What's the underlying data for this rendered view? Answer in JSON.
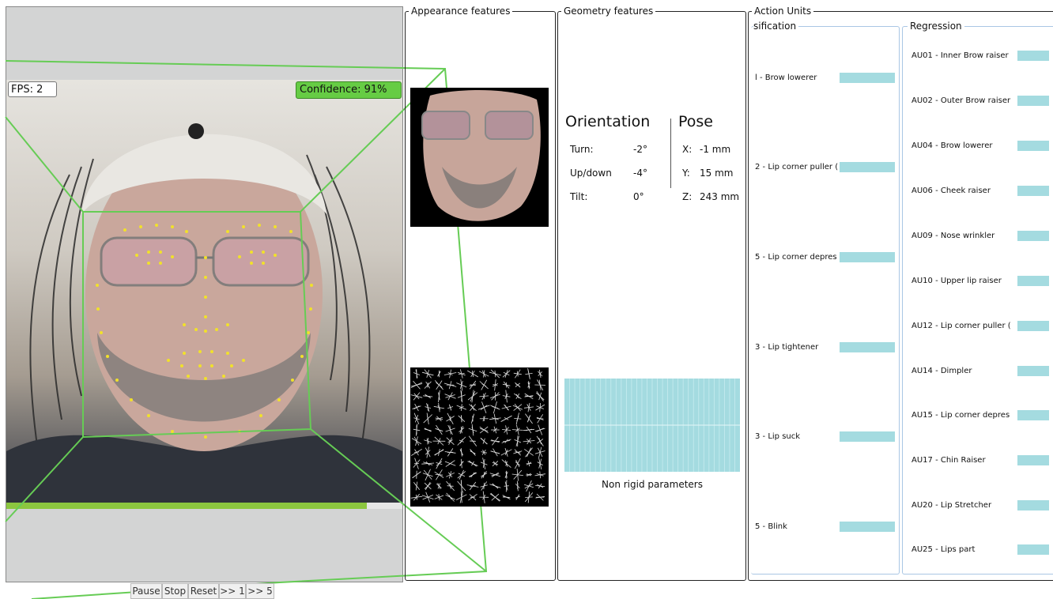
{
  "video": {
    "fps_label": "FPS: 2",
    "confidence_label": "Confidence: 91%",
    "confidence_value": 0.91,
    "accent_color": "#66cc44"
  },
  "appearance": {
    "title": "Appearance features"
  },
  "geometry": {
    "title": "Geometry features",
    "orientation_title": "Orientation",
    "pose_title": "Pose",
    "orientation_rows": [
      {
        "label": "Turn:",
        "value": "-2°"
      },
      {
        "label": "Up/down",
        "value": "-4°"
      },
      {
        "label": "Tilt:",
        "value": "0°"
      }
    ],
    "pose_rows": [
      {
        "label": "X:",
        "value": "-1 mm"
      },
      {
        "label": "Y:",
        "value": "15 mm"
      },
      {
        "label": "Z:",
        "value": "243 mm"
      }
    ],
    "non_rigid_label": "Non rigid parameters"
  },
  "action_units": {
    "title": "Action Units",
    "classification_title": "sification",
    "regression_title": "Regression",
    "classification_items": [
      "l - Brow lowerer",
      "2 - Lip corner puller (",
      "5 - Lip corner depres",
      "3 - Lip tightener",
      "3 - Lip suck",
      "5 - Blink"
    ],
    "regression_items": [
      "AU01 - Inner Brow raiser",
      "AU02 - Outer Brow raiser",
      "AU04 - Brow lowerer",
      "AU06 - Cheek raiser",
      "AU09 - Nose wrinkler",
      "AU10 - Upper lip raiser",
      "AU12 - Lip corner puller (",
      "AU14 - Dimpler",
      "AU15 - Lip corner depres",
      "AU17 - Chin Raiser",
      "AU20 - Lip Stretcher",
      "AU25 - Lips part"
    ],
    "bar_color": "#a4dbe0"
  },
  "controls": {
    "pause": "Pause",
    "stop": "Stop",
    "reset": "Reset",
    "skip1": ">> 1",
    "skip5": ">> 5"
  }
}
